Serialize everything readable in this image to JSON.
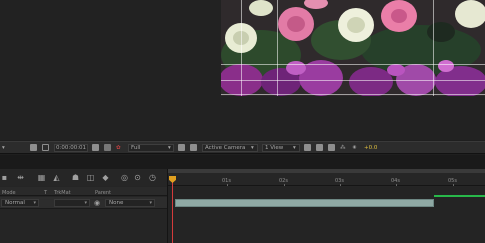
{
  "viewer_toolbar": {
    "timecode": "0:00:00:01",
    "resolution": "Full",
    "camera": "Active Camera",
    "views": "1 View",
    "exposure": "+0.0"
  },
  "timeline": {
    "columns": {
      "mode": "Mode",
      "t": "T",
      "trkmat": "TrkMat",
      "parent": "Parent"
    },
    "ruler_labels": [
      "01s",
      "02s",
      "03s",
      "04s",
      "05s"
    ],
    "layer": {
      "mode": "Normal",
      "parent": "None"
    }
  },
  "colors": {
    "layer_bar": "#8fa9a4",
    "cti": "#d43b3b",
    "work_area_end": "#28b84a",
    "exposure": "#e0c040"
  }
}
